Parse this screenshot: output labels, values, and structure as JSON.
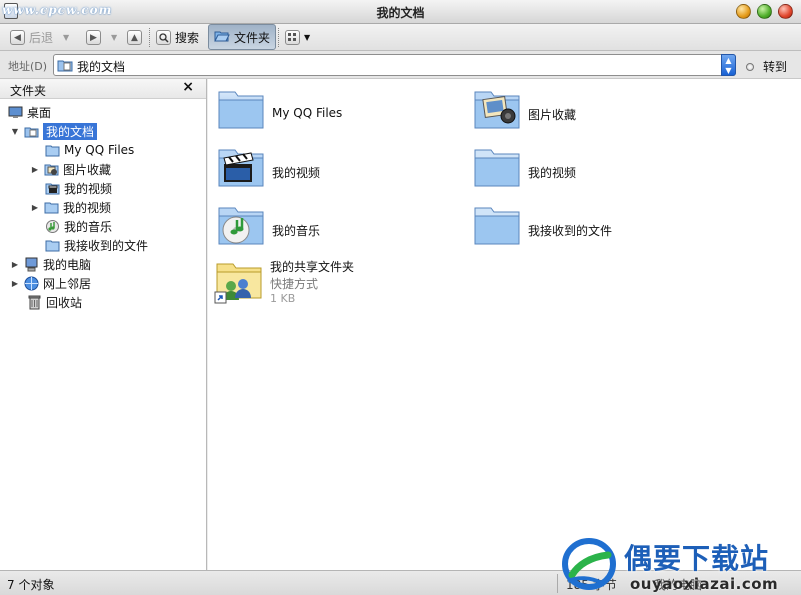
{
  "window": {
    "title": "我的文档",
    "watermark_top": "www.cpcw.com"
  },
  "toolbar": {
    "back_label": "后退",
    "search_label": "搜索",
    "folders_label": "文件夹"
  },
  "address": {
    "label": "地址(D)",
    "value": "我的文档",
    "go_label": "转到"
  },
  "sidebar": {
    "header": "文件夹",
    "close_glyph": "×",
    "nodes": [
      {
        "label": "桌面",
        "icon": "desktop-icon"
      },
      {
        "label": "我的文档",
        "icon": "my-documents-icon",
        "selected": true
      },
      {
        "label": "My QQ Files",
        "icon": "folder-icon"
      },
      {
        "label": "图片收藏",
        "icon": "pictures-folder-icon"
      },
      {
        "label": "我的视频",
        "icon": "video-folder-icon"
      },
      {
        "label": "我的视频",
        "icon": "folder-icon"
      },
      {
        "label": "我的音乐",
        "icon": "music-folder-icon"
      },
      {
        "label": "我接收到的文件",
        "icon": "folder-icon"
      },
      {
        "label": "我的电脑",
        "icon": "computer-icon"
      },
      {
        "label": "网上邻居",
        "icon": "network-icon"
      },
      {
        "label": "回收站",
        "icon": "recycle-bin-icon"
      }
    ]
  },
  "main": {
    "items": [
      {
        "name": "My QQ Files",
        "icon": "folder-icon"
      },
      {
        "name": "图片收藏",
        "icon": "pictures-folder-icon"
      },
      {
        "name": "我的视频",
        "icon": "video-folder-icon"
      },
      {
        "name": "我的视频",
        "icon": "folder-icon"
      },
      {
        "name": "我的音乐",
        "icon": "music-folder-icon"
      },
      {
        "name": "我接收到的文件",
        "icon": "folder-icon"
      },
      {
        "name": "我的共享文件夹",
        "sub": "快捷方式",
        "size": "1 KB",
        "icon": "shared-folder-shortcut-icon"
      }
    ]
  },
  "status": {
    "count": "7 个对象",
    "size": "185 字节",
    "location": "我的电脑"
  },
  "watermark": {
    "brand": "偶要下载站",
    "url": "ouyaoxiazai.com"
  }
}
